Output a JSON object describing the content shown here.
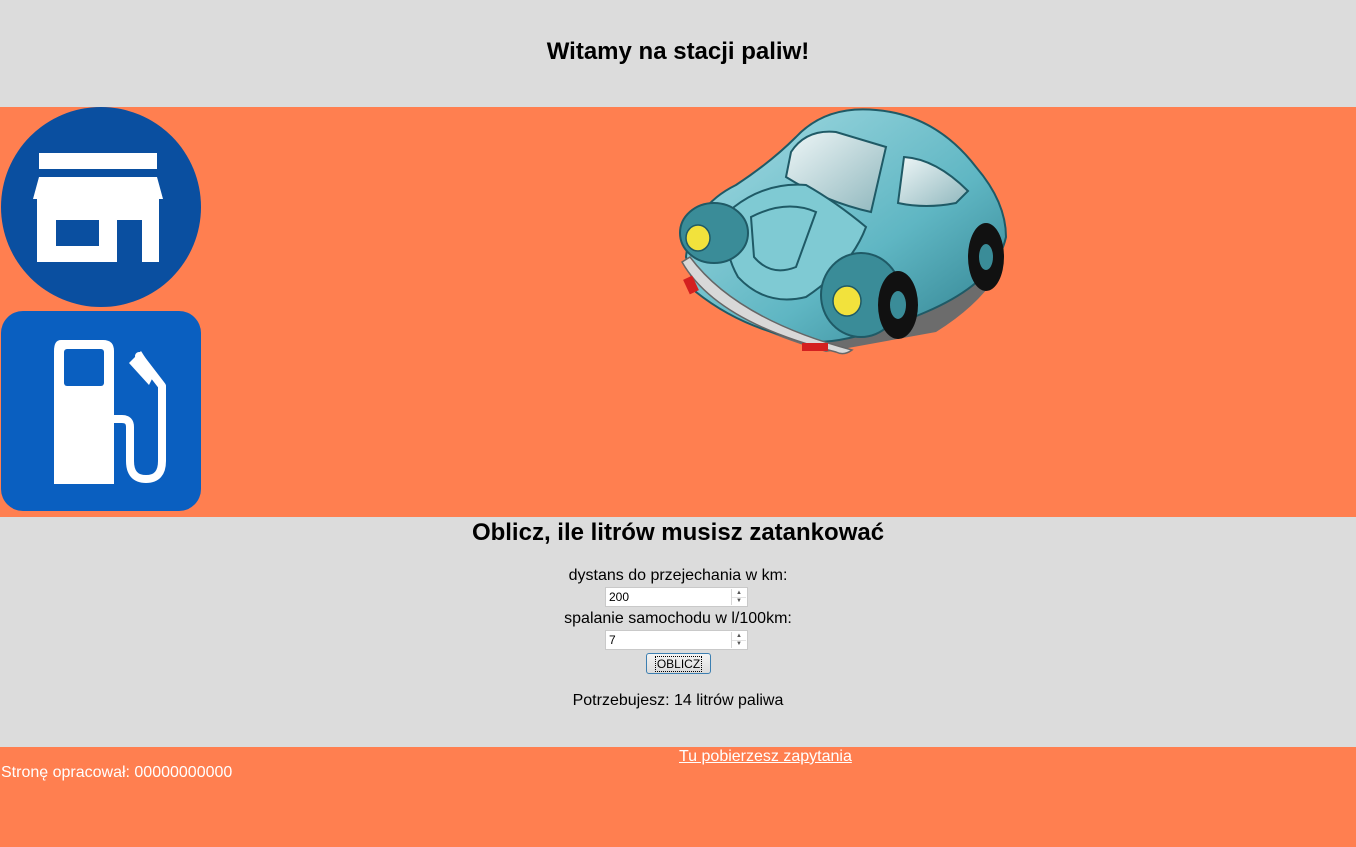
{
  "header": {
    "title": "Witamy na stacji paliw!"
  },
  "banner": {
    "icons": [
      "shop-icon",
      "fuel-pump-icon"
    ],
    "image": "car-image"
  },
  "calculator": {
    "heading": "Oblicz, ile litrów musisz zatankować",
    "distance_label": "dystans do przejechania w km:",
    "distance_value": "200",
    "consumption_label": "spalanie samochodu w l/100km:",
    "consumption_value": "7",
    "button_label": "OBLICZ",
    "result_text": "Potrzebujesz: 14 litrów paliwa"
  },
  "footer": {
    "link_text": "Tu pobierzesz zapytania",
    "author_text": "Stronę opracował: 00000000000"
  },
  "colors": {
    "gray_band": "#dcdcdc",
    "orange_band": "#ff7f50",
    "sign_blue": "#0a4fa0"
  }
}
